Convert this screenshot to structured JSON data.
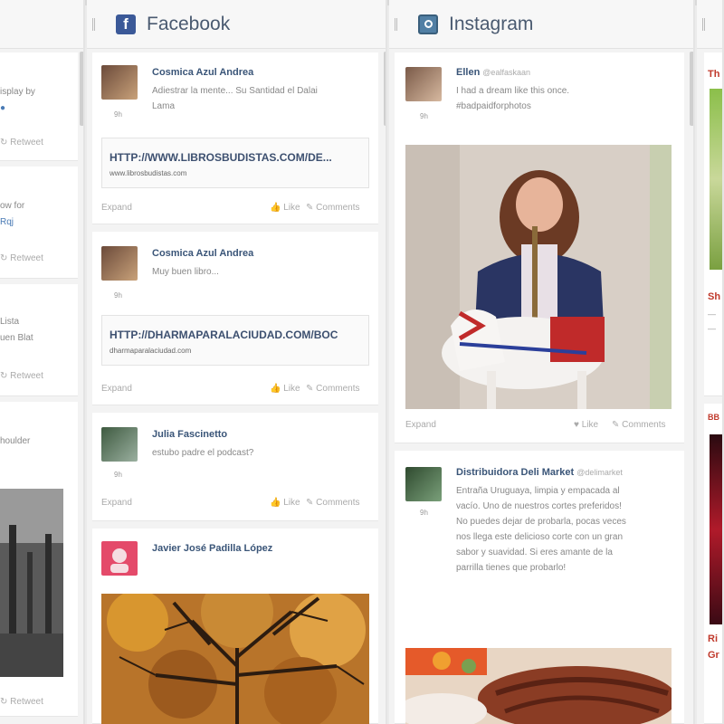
{
  "columns": {
    "facebook": {
      "title": "Facebook"
    },
    "instagram": {
      "title": "Instagram"
    }
  },
  "left_column": {
    "snippets": [
      "isplay by",
      "ow for",
      "Rqj",
      "Lista",
      "uen Blat",
      "houlder"
    ],
    "retweet_label": "Retweet"
  },
  "facebook_posts": [
    {
      "author": "Cosmica Azul Andrea",
      "text": "Adiestrar la mente... Su Santidad el Dalai Lama",
      "link_url": "HTTP://WWW.LIBROSBUDISTAS.COM/DE...",
      "link_domain": "www.librosbudistas.com"
    },
    {
      "author": "Cosmica Azul Andrea",
      "text": "Muy buen libro...",
      "link_url": "HTTP://DHARMAPARALACIUDAD.COM/BOC",
      "link_domain": "dharmaparalaciudad.com"
    },
    {
      "author": "Julia Fascinetto",
      "text": "estubo padre el podcast?"
    },
    {
      "author": "Javier José Padilla López"
    }
  ],
  "instagram_posts": [
    {
      "author": "Ellen",
      "handle": "@ealfaskaan",
      "text_lines": [
        "I had a dream like this once.",
        "#badpaidforphotos"
      ]
    },
    {
      "author": "Distribuidora Deli Market",
      "handle": "@delimarket",
      "text_lines": [
        "Entraña Uruguaya, limpia y empacada al",
        "vacío. Uno de nuestros cortes preferidos!",
        "No puedes dejar de probarla, pocas veces",
        "nos llega este delicioso corte con un gran",
        "sabor y suavidad. Si eres amante de la",
        "parrilla tienes que probarlo!"
      ]
    }
  ],
  "actions": {
    "expand": "Expand",
    "like": "Like",
    "comments": "Comments",
    "timestamp": "9h"
  },
  "right_column": {
    "snippets": [
      "Th",
      "Sh",
      "Ri",
      "Gr",
      "BB"
    ]
  },
  "colors": {
    "facebook_blue": "#3b5998",
    "instagram_blue": "#517fa4",
    "author_blue": "#3a5578",
    "accent_red": "#c0392b"
  }
}
